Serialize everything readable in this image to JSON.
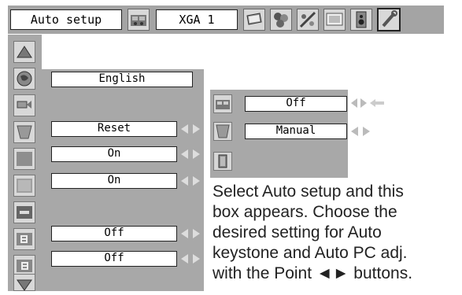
{
  "top_menu": {
    "left_label": "Auto setup",
    "source_label": "XGA 1",
    "icons": [
      "computer-adjust-icon",
      "monitor-icon",
      "color-balls-icon",
      "color-slider-icon",
      "screen-image-icon",
      "speaker-icon",
      "tools-wrench-icon"
    ]
  },
  "left_menu": {
    "icons": [
      "scroll-up-icon",
      "language-globe-icon",
      "keystone-icon",
      "trapezoid-icon",
      "blank-gray-icon",
      "background-blue-icon",
      "logo-icon",
      "ceiling-icon",
      "rear-icon",
      "scroll-down-icon"
    ]
  },
  "settings": {
    "language": "English",
    "keystone": "Reset",
    "blue_back": "On",
    "display": "On",
    "ceiling": "Off",
    "rear": "Off"
  },
  "popup": {
    "auto_pc_adj": "Off",
    "auto_keystone": "Manual"
  },
  "caption": {
    "line1": "Select Auto setup and this",
    "line2": "box appears. Choose the",
    "line3": "desired setting for Auto",
    "line4": "keystone and Auto PC adj.",
    "line5": "with the Point ◄► buttons."
  }
}
